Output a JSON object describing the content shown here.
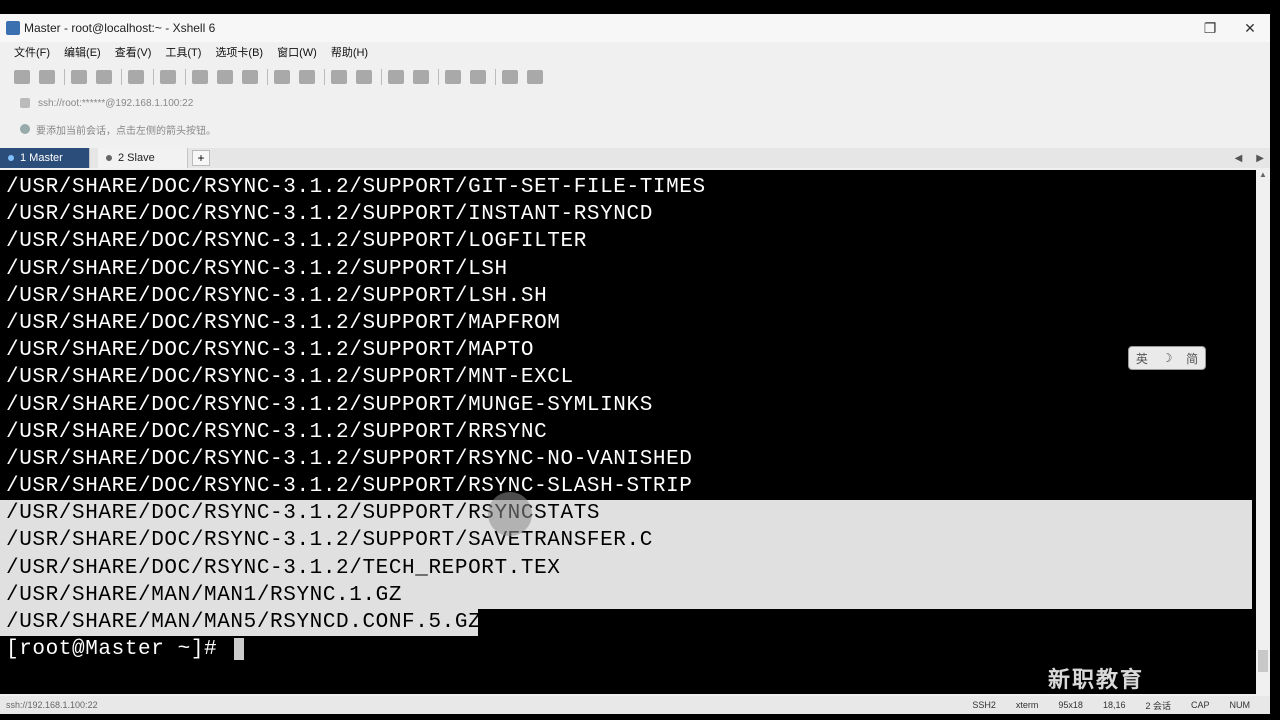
{
  "window": {
    "title": "Master - root@localhost:~ - Xshell 6",
    "controls": {
      "restore": "❐",
      "close": "✕"
    }
  },
  "menu": [
    "文件(F)",
    "编辑(E)",
    "查看(V)",
    "工具(T)",
    "选项卡(B)",
    "窗口(W)",
    "帮助(H)"
  ],
  "address": {
    "text": "ssh://root:******@192.168.1.100:22"
  },
  "hint": {
    "text": "要添加当前会话，点击左侧的箭头按钮。"
  },
  "tabs": [
    {
      "label": "1 Master",
      "active": true
    },
    {
      "label": "2 Slave",
      "active": false
    }
  ],
  "tab_add": "+",
  "tab_nav": {
    "prev": "◀",
    "next": "▶"
  },
  "terminal": {
    "lines": [
      "/USR/SHARE/DOC/RSYNC-3.1.2/SUPPORT/GIT-SET-FILE-TIMES",
      "/USR/SHARE/DOC/RSYNC-3.1.2/SUPPORT/INSTANT-RSYNCD",
      "/USR/SHARE/DOC/RSYNC-3.1.2/SUPPORT/LOGFILTER",
      "/USR/SHARE/DOC/RSYNC-3.1.2/SUPPORT/LSH",
      "/USR/SHARE/DOC/RSYNC-3.1.2/SUPPORT/LSH.SH",
      "/USR/SHARE/DOC/RSYNC-3.1.2/SUPPORT/MAPFROM",
      "/USR/SHARE/DOC/RSYNC-3.1.2/SUPPORT/MAPTO",
      "/USR/SHARE/DOC/RSYNC-3.1.2/SUPPORT/MNT-EXCL",
      "/USR/SHARE/DOC/RSYNC-3.1.2/SUPPORT/MUNGE-SYMLINKS",
      "/USR/SHARE/DOC/RSYNC-3.1.2/SUPPORT/RRSYNC",
      "/USR/SHARE/DOC/RSYNC-3.1.2/SUPPORT/RSYNC-NO-VANISHED",
      "/USR/SHARE/DOC/RSYNC-3.1.2/SUPPORT/RSYNC-SLASH-STRIP",
      "/USR/SHARE/DOC/RSYNC-3.1.2/SUPPORT/RSYNCSTATS",
      "/USR/SHARE/DOC/RSYNC-3.1.2/SUPPORT/SAVETRANSFER.C",
      "/USR/SHARE/DOC/RSYNC-3.1.2/TECH_REPORT.TEX",
      "/USR/SHARE/MAN/MAN1/RSYNC.1.GZ",
      "/USR/SHARE/MAN/MAN5/RSYNCD.CONF.5.GZ"
    ],
    "prompt": "[root@Master ~]# "
  },
  "ime": {
    "a": "英",
    "b": "☽",
    "c": "简"
  },
  "status": {
    "left": "ssh://192.168.1.100:22",
    "items": [
      "SSH2",
      "xterm",
      "95x18",
      "18,16",
      "2 会话",
      "CAP",
      "NUM"
    ]
  },
  "watermark": "新职教育"
}
